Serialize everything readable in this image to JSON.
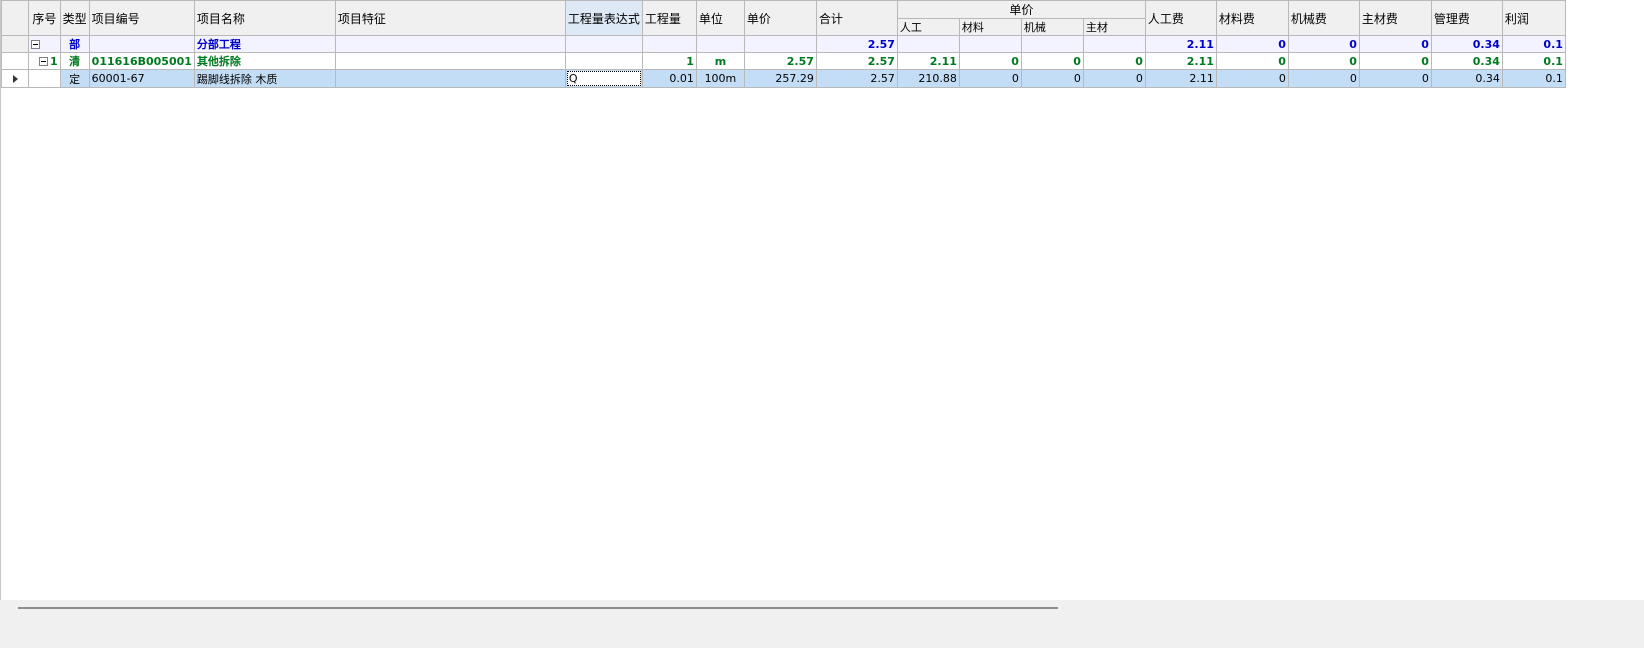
{
  "header": {
    "index": "序号",
    "type": "类型",
    "code": "项目编号",
    "name": "项目名称",
    "feature": "项目特征",
    "qty_expr": "工程量表达式",
    "qty": "工程量",
    "unit": "单位",
    "unit_price": "单价",
    "total": "合计",
    "unit_price_group": "单价",
    "labor": "人工",
    "material": "材料",
    "machine": "机械",
    "main_material": "主材",
    "labor_fee": "人工费",
    "material_fee": "材料费",
    "machine_fee": "机械费",
    "main_material_fee": "主材费",
    "mgmt_fee": "管理费",
    "profit": "利润"
  },
  "rows": [
    {
      "index": "",
      "type": "部",
      "code": "",
      "name": "分部工程",
      "feature": "",
      "qty_expr": "",
      "qty": "",
      "unit": "",
      "unit_price": "",
      "total": "2.57",
      "labor": "",
      "material": "",
      "machine": "",
      "main_material": "",
      "labor_fee": "2.11",
      "material_fee": "0",
      "machine_fee": "0",
      "main_material_fee": "0",
      "mgmt_fee": "0.34",
      "profit": "0.1"
    },
    {
      "index": "1",
      "type": "清",
      "code": "011616B005001",
      "name": "其他拆除",
      "feature": "",
      "qty_expr": "",
      "qty": "1",
      "unit": "m",
      "unit_price": "2.57",
      "total": "2.57",
      "labor": "2.11",
      "material": "0",
      "machine": "0",
      "main_material": "0",
      "labor_fee": "2.11",
      "material_fee": "0",
      "machine_fee": "0",
      "main_material_fee": "0",
      "mgmt_fee": "0.34",
      "profit": "0.1"
    },
    {
      "index": "",
      "type": "定",
      "code": "60001-67",
      "name": "踢脚线拆除 木质",
      "feature": "",
      "qty_expr": "Q",
      "qty": "0.01",
      "unit": "100m",
      "unit_price": "257.29",
      "total": "2.57",
      "labor": "210.88",
      "material": "0",
      "machine": "0",
      "main_material": "0",
      "labor_fee": "2.11",
      "material_fee": "0",
      "machine_fee": "0",
      "main_material_fee": "0",
      "mgmt_fee": "0.34",
      "profit": "0.1"
    }
  ]
}
